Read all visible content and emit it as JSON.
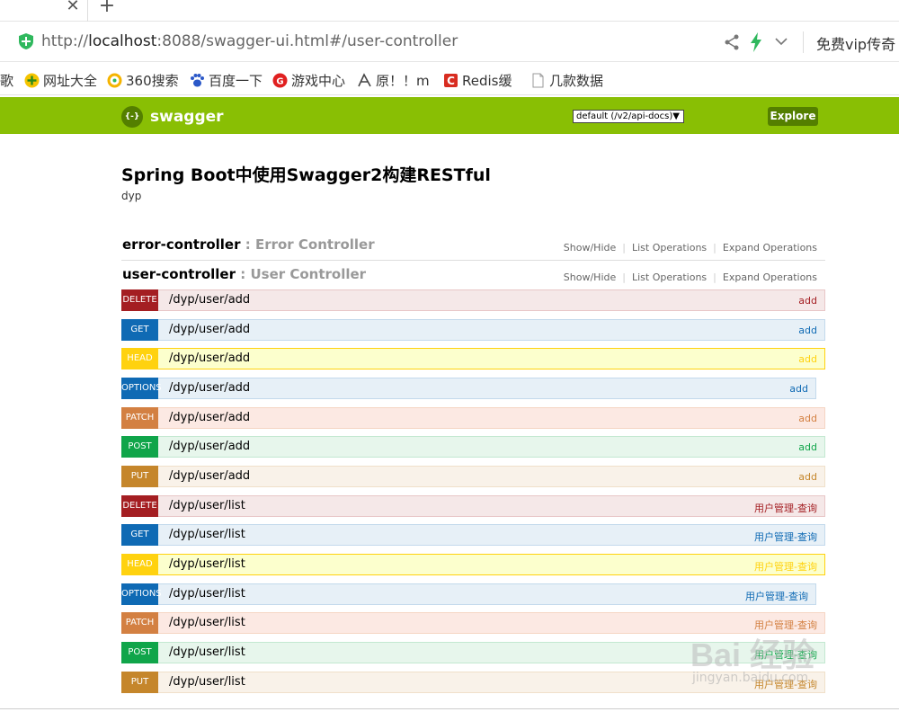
{
  "browser": {
    "address_scheme": "http://",
    "address_host": "localhost",
    "address_rest": ":8088/swagger-ui.html#/user-controller",
    "vip_text": "免费vip传奇",
    "bookmarks": [
      {
        "label": "歌",
        "icon": ""
      },
      {
        "label": "网址大全",
        "icon": "plus-circle-icon"
      },
      {
        "label": "360搜索",
        "icon": "360-search-icon"
      },
      {
        "label": "百度一下",
        "icon": "baidu-paw-icon"
      },
      {
        "label": "游戏中心",
        "icon": "game-center-icon"
      },
      {
        "label": "原！！m",
        "icon": "yuan-icon"
      },
      {
        "label": "Redis缓",
        "icon": "redis-icon"
      },
      {
        "label": "几款数据",
        "icon": "page-icon"
      }
    ]
  },
  "swagger": {
    "logo_text": "swagger",
    "logo_glyph": "{-}",
    "api_select": "default (/v2/api-docs)",
    "explore_label": "Explore",
    "title": "Spring Boot中使用Swagger2构建RESTful",
    "description": "dyp"
  },
  "resources": [
    {
      "name": "error-controller",
      "desc": " : Error Controller"
    },
    {
      "name": "user-controller",
      "desc": " : User Controller"
    }
  ],
  "resource_ops": {
    "show_hide": "Show/Hide",
    "list_ops": "List Operations",
    "expand_ops": "Expand Operations"
  },
  "operations": [
    {
      "method": "DELETE",
      "path": "/dyp/user/add",
      "summary": "add"
    },
    {
      "method": "GET",
      "path": "/dyp/user/add",
      "summary": "add"
    },
    {
      "method": "HEAD",
      "path": "/dyp/user/add",
      "summary": "add"
    },
    {
      "method": "OPTIONS",
      "path": "/dyp/user/add",
      "summary": "add"
    },
    {
      "method": "PATCH",
      "path": "/dyp/user/add",
      "summary": "add"
    },
    {
      "method": "POST",
      "path": "/dyp/user/add",
      "summary": "add"
    },
    {
      "method": "PUT",
      "path": "/dyp/user/add",
      "summary": "add"
    },
    {
      "method": "DELETE",
      "path": "/dyp/user/list",
      "summary": "用户管理-查询"
    },
    {
      "method": "GET",
      "path": "/dyp/user/list",
      "summary": "用户管理-查询"
    },
    {
      "method": "HEAD",
      "path": "/dyp/user/list",
      "summary": "用户管理-查询"
    },
    {
      "method": "OPTIONS",
      "path": "/dyp/user/list",
      "summary": "用户管理-查询"
    },
    {
      "method": "PATCH",
      "path": "/dyp/user/list",
      "summary": "用户管理-查询"
    },
    {
      "method": "POST",
      "path": "/dyp/user/list",
      "summary": "用户管理-查询"
    },
    {
      "method": "PUT",
      "path": "/dyp/user/list",
      "summary": "用户管理-查询"
    }
  ],
  "watermark": {
    "main": "Bai 经验",
    "sub": "jingyan.baidu.com"
  },
  "colors": {
    "swagger_green": "#89bf04",
    "swagger_dark": "#547f00"
  }
}
